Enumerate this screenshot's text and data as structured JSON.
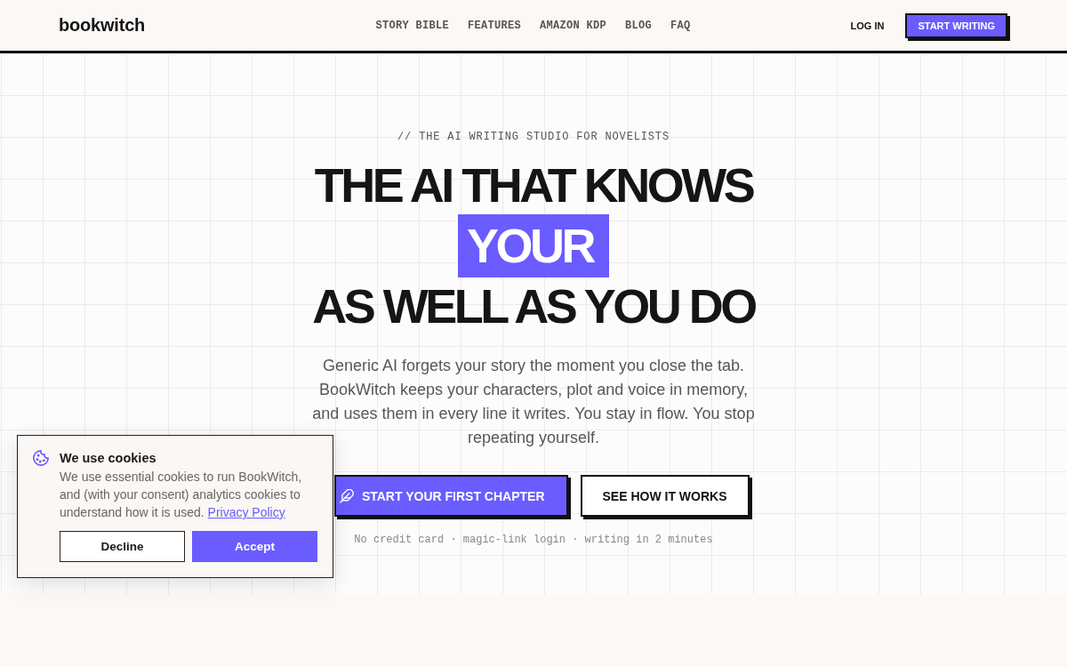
{
  "header": {
    "logo": "bookwitch",
    "nav": [
      {
        "label": "STORY BIBLE"
      },
      {
        "label": "FEATURES"
      },
      {
        "label": "AMAZON KDP"
      },
      {
        "label": "BLOG"
      },
      {
        "label": "FAQ"
      }
    ],
    "login": "LOG IN",
    "cta": "START WRITING"
  },
  "hero": {
    "eyebrow": "// THE AI WRITING STUDIO FOR NOVELISTS",
    "headline": [
      {
        "text": "THE AI THAT KNOWS",
        "highlighted": false
      },
      {
        "text": "YOUR",
        "highlighted": true
      },
      {
        "text": "AS WELL AS YOU DO",
        "highlighted": false
      }
    ],
    "description": "Generic AI forgets your story the moment you close the tab.\nBookWitch keeps your characters, plot and voice in memory,\nand uses them in every line it writes. You stay in flow. You stop\nrepeating yourself.",
    "buttons": [
      {
        "label": "START YOUR FIRST CHAPTER",
        "kind": "primary"
      },
      {
        "label": "SEE HOW IT WORKS",
        "kind": "secondary"
      }
    ],
    "note": "No credit card · magic-link login · writing in 2 minutes"
  },
  "cookie_banner": {
    "title": "We use cookies",
    "text": "We use essential cookies to run BookWitch,\nand (with your consent) analytics cookies to\nunderstand how it is used.",
    "link": "Privacy Policy",
    "buttons": [
      {
        "label": "Decline",
        "kind": "secondary"
      },
      {
        "label": "Accept",
        "kind": "primary"
      }
    ]
  }
}
